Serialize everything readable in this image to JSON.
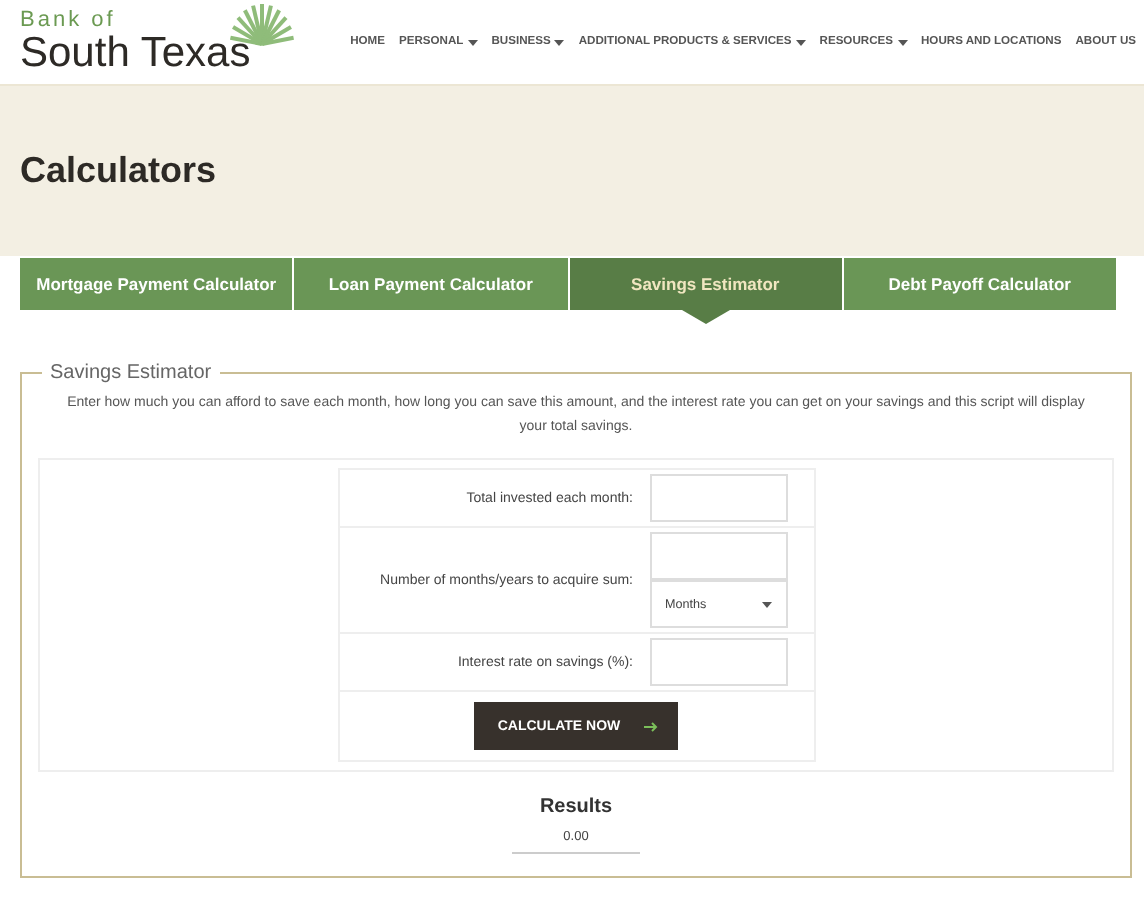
{
  "logo": {
    "line_1": "Bank of",
    "line_2": "South Texas"
  },
  "nav": [
    {
      "label": "HOME",
      "dropdown": false
    },
    {
      "label": "PERSONAL",
      "dropdown": true
    },
    {
      "label": "BUSINESS",
      "dropdown": true
    },
    {
      "label": "ADDITIONAL PRODUCTS & SERVICES",
      "dropdown": true
    },
    {
      "label": "RESOURCES",
      "dropdown": true
    },
    {
      "label": "HOURS AND LOCATIONS",
      "dropdown": false
    },
    {
      "label": "ABOUT US",
      "dropdown": false
    }
  ],
  "page_title": "Calculators",
  "tabs": [
    {
      "label": "Mortgage Payment Calculator",
      "selected": false
    },
    {
      "label": "Loan Payment Calculator",
      "selected": false
    },
    {
      "label": "Savings Estimator",
      "selected": true
    },
    {
      "label": "Debt Payoff Calculator",
      "selected": false
    }
  ],
  "form": {
    "legend": "Savings Estimator",
    "description": "Enter how much you can afford to save each month, how long you can save this amount, and the interest rate you can get on your savings and this script will display your total savings.",
    "rows": [
      {
        "label": "Total invested each month:",
        "kind": "input"
      },
      {
        "label": "Number of months/years to acquire sum:",
        "kind": "input_select",
        "select_value": "Months"
      },
      {
        "label": "Interest rate on savings (%):",
        "kind": "input"
      }
    ],
    "button": "CALCULATE NOW",
    "results_title": "Results",
    "result_value": "0.00"
  }
}
